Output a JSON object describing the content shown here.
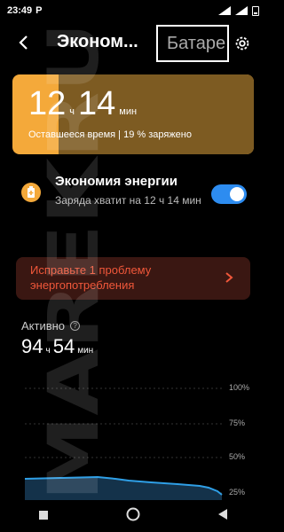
{
  "status_bar": {
    "time": "23:49",
    "carrier": "P"
  },
  "header": {
    "title": "Эконом...",
    "tab_battery": "Батаре"
  },
  "card": {
    "hours": "12",
    "hours_unit": "ч",
    "minutes": "14",
    "minutes_unit": "мин",
    "subtitle": "Оставшееся время | 19 % заряжено"
  },
  "saver": {
    "title": "Экономия энергии",
    "subtitle": "Заряда хватит на 12 ч 14 мин",
    "enabled": true
  },
  "fix": {
    "label": "Исправьте 1 проблему энергопотребления"
  },
  "active": {
    "label": "Активно",
    "hours": "94",
    "hours_unit": "ч",
    "minutes": "54",
    "minutes_unit": "мин"
  },
  "chart": {
    "ticks": [
      "100%",
      "75%",
      "50%",
      "25%"
    ]
  },
  "watermark": "MAREKRU",
  "colors": {
    "accent_orange": "#f4a93a",
    "toggle_blue": "#2d8cf0",
    "warning_red": "#f0573a",
    "line_blue": "#2f9fe6"
  }
}
